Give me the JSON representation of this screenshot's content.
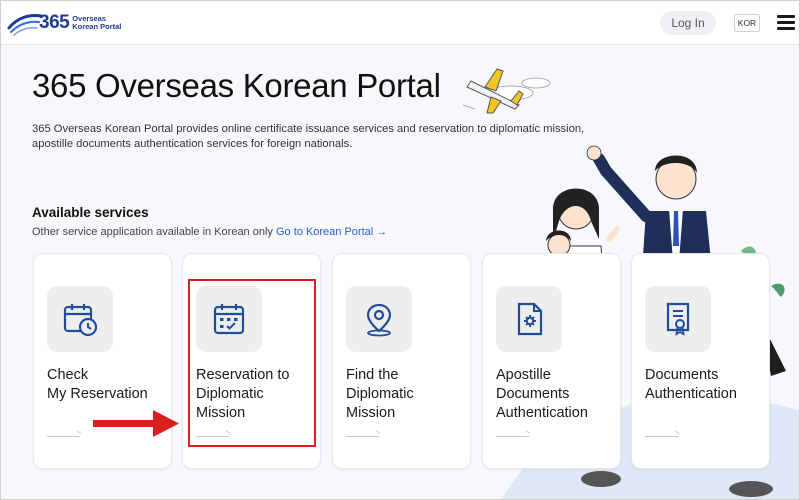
{
  "header": {
    "logo_number": "365",
    "logo_line1": "Overseas",
    "logo_line2": "Korean Portal",
    "login_label": "Log In",
    "language_label": "KOR"
  },
  "hero": {
    "title": "365 Overseas Korean Portal",
    "description": "365 Overseas Korean Portal provides online certificate issuance services and reservation to diplomatic mission, apostille documents authentication services for foreign nationals."
  },
  "services": {
    "title": "Available services",
    "subtitle": "Other service application available in Korean only",
    "link_label": "Go to Korean Portal →",
    "cards": [
      {
        "label_line1": "Check",
        "label_line2": "My Reservation",
        "label_line3": "",
        "icon": "calendar-clock-icon"
      },
      {
        "label_line1": "Reservation to",
        "label_line2": "Diplomatic",
        "label_line3": "Mission",
        "icon": "calendar-check-icon"
      },
      {
        "label_line1": "Find the",
        "label_line2": "Diplomatic",
        "label_line3": "Mission",
        "icon": "map-pin-icon"
      },
      {
        "label_line1": "Apostille",
        "label_line2": "Documents",
        "label_line3": "Authentication",
        "icon": "document-gear-icon"
      },
      {
        "label_line1": "Documents",
        "label_line2": "Authentication",
        "label_line3": "",
        "icon": "certificate-icon"
      }
    ]
  },
  "colors": {
    "brand": "#1f3b8f",
    "link": "#2a5bd7",
    "highlight": "#d81f1f",
    "icon_blue": "#1f4f9c"
  }
}
